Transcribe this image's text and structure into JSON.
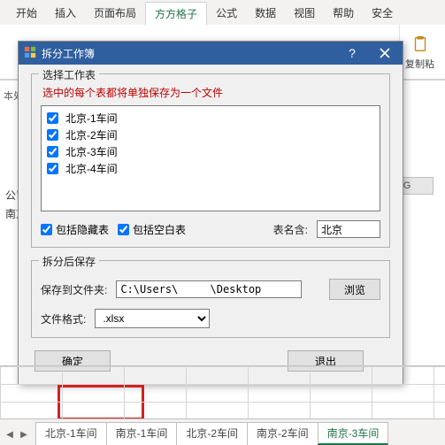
{
  "ribbon": {
    "tabs": [
      "开始",
      "插入",
      "页面布局",
      "方方格子",
      "公式",
      "数据",
      "视图",
      "帮助",
      "安全"
    ],
    "active_index": 3,
    "copy_group_label": "复制粘"
  },
  "dialog": {
    "title": "拆分工作簿",
    "group1_title": "选择工作表",
    "hint": "选中的每个表都将单独保存为一个文件",
    "items": [
      {
        "label": "北京-1车间",
        "checked": true
      },
      {
        "label": "北京-2车间",
        "checked": true
      },
      {
        "label": "北京-3车间",
        "checked": true
      },
      {
        "label": "北京-4车间",
        "checked": true
      }
    ],
    "include_hidden_label": "包括隐藏表",
    "include_hidden_checked": true,
    "include_blank_label": "包括空白表",
    "include_blank_checked": true,
    "table_name_label": "表名含:",
    "table_name_value": "北京",
    "group2_title": "拆分后保存",
    "save_folder_label": "保存到文件夹:",
    "save_folder_value": "C:\\Users\\     \\Desktop",
    "browse_label": "浏览",
    "file_format_label": "文件格式:",
    "file_format_value": ".xlsx",
    "ok_label": "确定",
    "exit_label": "退出"
  },
  "sheet_tabs": [
    "北京-1车间",
    "南京-1车间",
    "北京-2车间",
    "南京-2车间",
    "南京-3车间"
  ],
  "active_sheet_index": 4,
  "column_header": "G",
  "left_cells": [
    "公司",
    "南京"
  ],
  "formula_prefix": "本处"
}
